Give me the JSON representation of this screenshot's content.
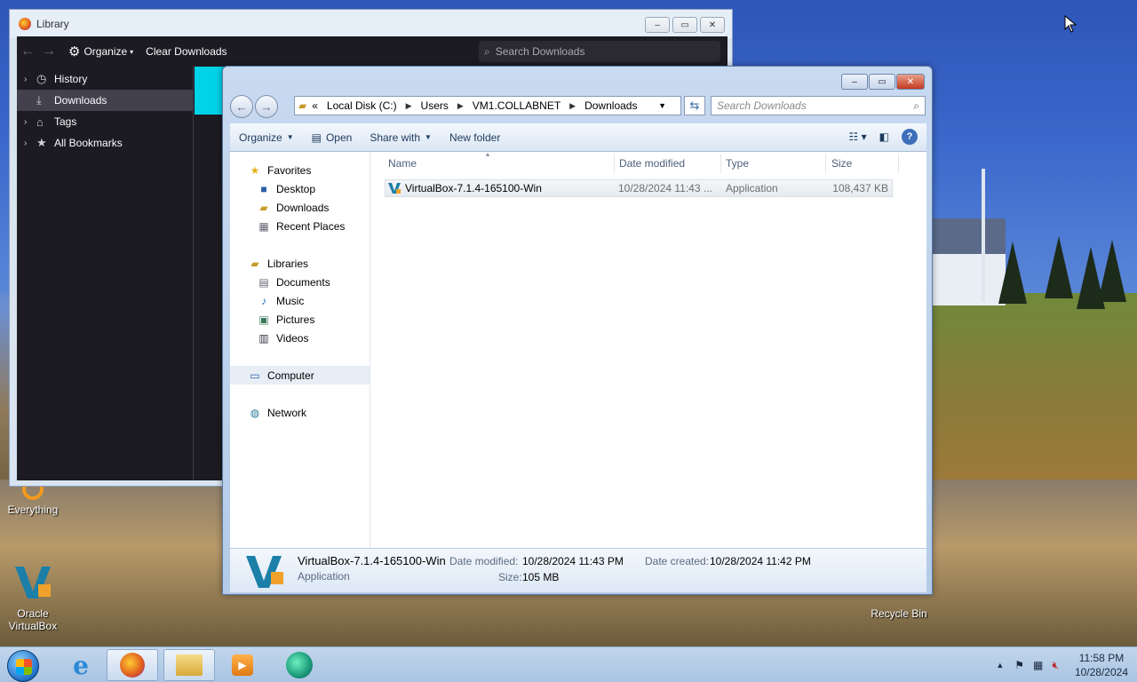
{
  "desktop": {
    "icons": [
      {
        "label": "Everything"
      },
      {
        "label": "Oracle VirtualBox"
      },
      {
        "label": "Recycle Bin"
      }
    ]
  },
  "library": {
    "title": "Library",
    "organize": "Organize",
    "clear_downloads": "Clear Downloads",
    "search_placeholder": "Search Downloads",
    "tree": [
      {
        "label": "History"
      },
      {
        "label": "Downloads"
      },
      {
        "label": "Tags"
      },
      {
        "label": "All Bookmarks"
      }
    ]
  },
  "explorer": {
    "address": {
      "prefix": "«",
      "crumbs": [
        "Local Disk (C:)",
        "Users",
        "VM1.COLLABNET",
        "Downloads"
      ]
    },
    "search_placeholder": "Search Downloads",
    "commands": {
      "organize": "Organize",
      "open": "Open",
      "share_with": "Share with",
      "new_folder": "New folder"
    },
    "nav": {
      "favorites": "Favorites",
      "desktop": "Desktop",
      "downloads": "Downloads",
      "recent": "Recent Places",
      "libraries": "Libraries",
      "documents": "Documents",
      "music": "Music",
      "pictures": "Pictures",
      "videos": "Videos",
      "computer": "Computer",
      "network": "Network"
    },
    "columns": {
      "name": "Name",
      "date": "Date modified",
      "type": "Type",
      "size": "Size"
    },
    "files": [
      {
        "name": "VirtualBox-7.1.4-165100-Win",
        "date": "10/28/2024 11:43 ...",
        "type": "Application",
        "size": "108,437 KB"
      }
    ],
    "details": {
      "name": "VirtualBox-7.1.4-165100-Win",
      "type": "Application",
      "date_modified_label": "Date modified:",
      "date_modified": "10/28/2024 11:43 PM",
      "date_created_label": "Date created:",
      "date_created": "10/28/2024 11:42 PM",
      "size_label": "Size:",
      "size": "105 MB"
    }
  },
  "taskbar": {
    "time": "11:58 PM",
    "date": "10/28/2024"
  }
}
